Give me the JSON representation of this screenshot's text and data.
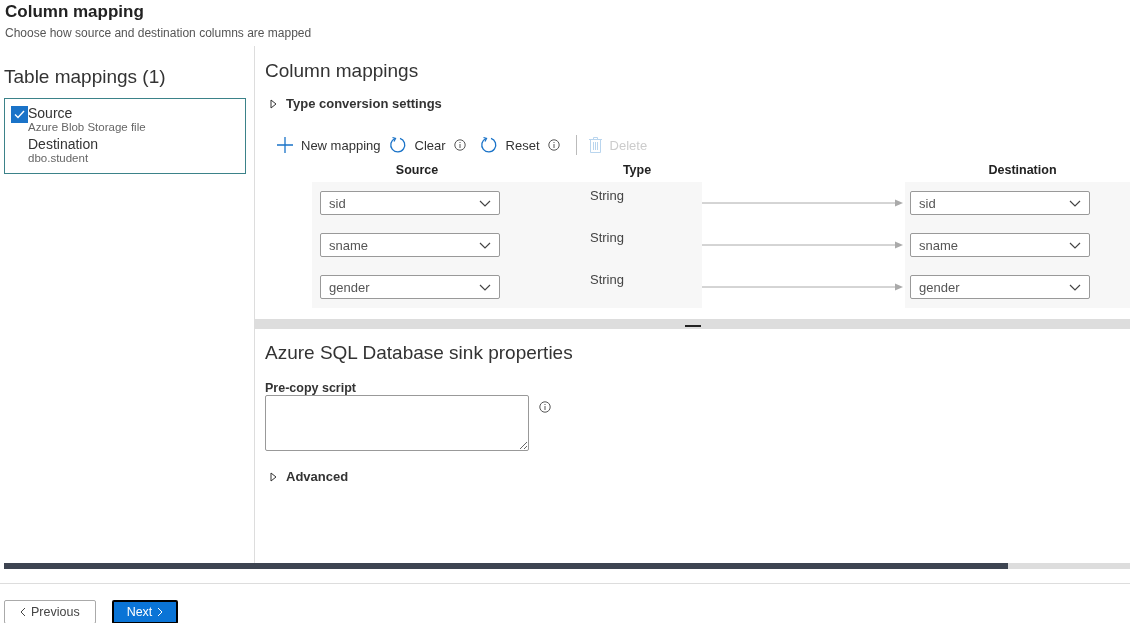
{
  "header": {
    "title": "Column mapping",
    "subtitle": "Choose how source and destination columns are mapped"
  },
  "table_mappings": {
    "title": "Table mappings (1)",
    "items": [
      {
        "checked": true,
        "selected": true,
        "source_label": "Source",
        "source": "Azure Blob Storage file",
        "destination_label": "Destination",
        "destination": "dbo.student"
      }
    ]
  },
  "column_mappings": {
    "title": "Column mappings",
    "type_conversion": {
      "label": "Type conversion settings",
      "expanded": false
    },
    "toolbar": [
      {
        "kind": "add",
        "label": "New mapping",
        "info": false,
        "disabled": false
      },
      {
        "kind": "refresh",
        "label": "Clear",
        "info": true,
        "disabled": false
      },
      {
        "kind": "refresh",
        "label": "Reset",
        "info": true,
        "disabled": false
      },
      {
        "kind": "delete",
        "label": "Delete",
        "info": false,
        "disabled": true
      }
    ],
    "columns": [
      "Source",
      "Type",
      "Destination"
    ],
    "rows": [
      {
        "source": "sid",
        "type": "String",
        "destination": "sid"
      },
      {
        "source": "sname",
        "type": "String",
        "destination": "sname"
      },
      {
        "source": "gender",
        "type": "String",
        "destination": "gender"
      }
    ]
  },
  "sink": {
    "title": "Azure SQL Database sink properties",
    "pre_copy_script": {
      "label": "Pre-copy script"
    },
    "advanced": {
      "label": "Advanced",
      "expanded": false
    }
  },
  "buttons": [
    {
      "kind": "previous",
      "label": "Previous",
      "primary": false
    },
    {
      "kind": "next",
      "label": "Next",
      "primary": true
    }
  ]
}
